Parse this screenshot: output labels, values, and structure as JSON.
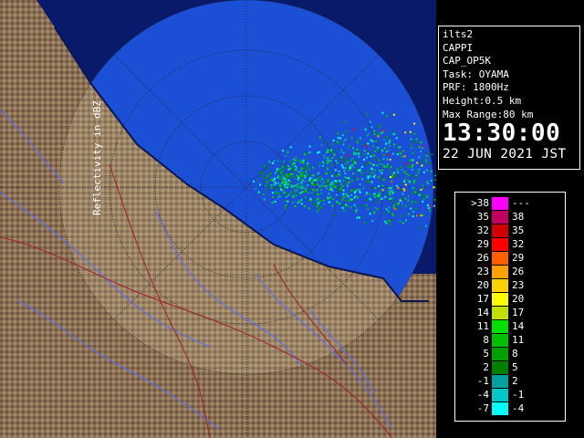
{
  "info": {
    "station": "ilts2",
    "product": "CAPPI",
    "product_code": "CAP_OP5K",
    "task": "Task: OYAMA",
    "prf": "PRF: 1800Hz",
    "height": "Height:0.5 km",
    "max_range": "Max Range:80 km",
    "time": "13:30:00",
    "date": "22 JUN 2021 JST"
  },
  "legend": {
    "title": "Reflectivity in dBZ",
    "rows": [
      {
        "low": ">38",
        "high": "---",
        "color": "#ff00ff"
      },
      {
        "low": "35",
        "high": "38",
        "color": "#c00060"
      },
      {
        "low": "32",
        "high": "35",
        "color": "#d00000"
      },
      {
        "low": "29",
        "high": "32",
        "color": "#ff0000"
      },
      {
        "low": "26",
        "high": "29",
        "color": "#ff6000"
      },
      {
        "low": "23",
        "high": "26",
        "color": "#ffa000"
      },
      {
        "low": "20",
        "high": "23",
        "color": "#ffd000"
      },
      {
        "low": "17",
        "high": "20",
        "color": "#ffff00"
      },
      {
        "low": "14",
        "high": "17",
        "color": "#c0e000"
      },
      {
        "low": "11",
        "high": "14",
        "color": "#00e000"
      },
      {
        "low": "8",
        "high": "11",
        "color": "#00c000"
      },
      {
        "low": "5",
        "high": "8",
        "color": "#00a000"
      },
      {
        "low": "2",
        "high": "5",
        "color": "#008000"
      },
      {
        "low": "-1",
        "high": "2",
        "color": "#00a0a0"
      },
      {
        "low": "-4",
        "high": "-1",
        "color": "#00c8c8"
      },
      {
        "low": "-7",
        "high": "-4",
        "color": "#00ffff"
      }
    ]
  },
  "map_colors": {
    "terrain": "#8a7054",
    "sea": "#1a4fd6",
    "rivers": "#5a6cff",
    "borders": "#a0202a"
  }
}
